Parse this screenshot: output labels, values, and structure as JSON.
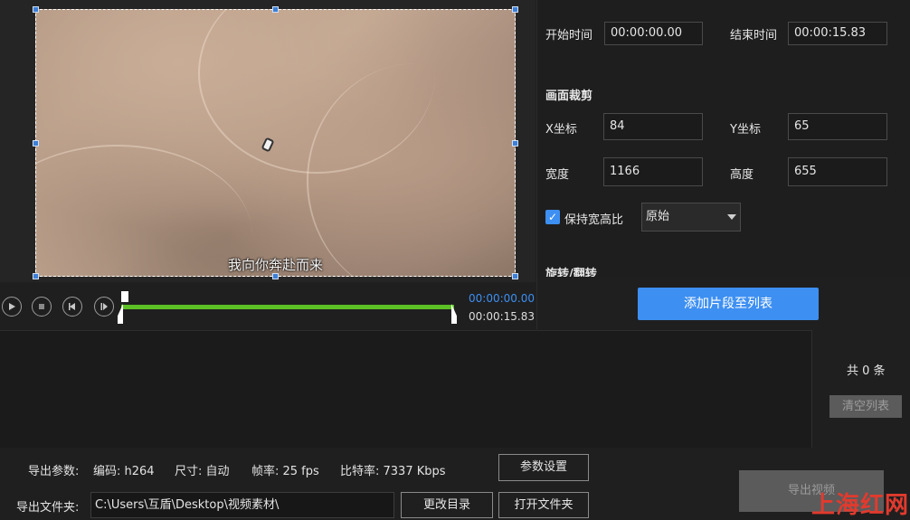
{
  "subtitle": "我向你奔赴而来",
  "timeline": {
    "current": "00:00:00.00",
    "total": "00:00:15.83",
    "progress_color": "#5cc125"
  },
  "trim": {
    "start_label": "开始时间",
    "start_value": "00:00:00.00",
    "end_label": "结束时间",
    "end_value": "00:00:15.83"
  },
  "crop": {
    "section_title": "画面裁剪",
    "x_label": "X坐标",
    "x_value": "84",
    "y_label": "Y坐标",
    "y_value": "65",
    "width_label": "宽度",
    "width_value": "1166",
    "height_label": "高度",
    "height_value": "655",
    "keep_ratio_label": "保持宽高比",
    "keep_ratio_checked": true,
    "ratio_option": "原始"
  },
  "rotate_section_title": "旋转/翻转",
  "add_button": "添加片段至列表",
  "list": {
    "count_text": "共 0 条",
    "clear_button": "清空列表"
  },
  "export": {
    "params_label": "导出参数:",
    "codec": "编码: h264",
    "size": "尺寸: 自动",
    "fps": "帧率: 25 fps",
    "bitrate": "比特率: 7337 Kbps",
    "params_button": "参数设置",
    "folder_label": "导出文件夹:",
    "folder_path": "C:\\Users\\互盾\\Desktop\\视频素材\\",
    "change_dir_button": "更改目录",
    "open_folder_button": "打开文件夹",
    "export_button": "导出视频"
  },
  "watermark": "上海红网",
  "colors": {
    "accent": "#3d8ff2",
    "background": "#1f1f1f"
  },
  "icons": [
    "play-icon",
    "stop-icon",
    "prev-frame-icon",
    "next-frame-icon",
    "checkbox-checked-icon",
    "dropdown-arrow-icon"
  ]
}
